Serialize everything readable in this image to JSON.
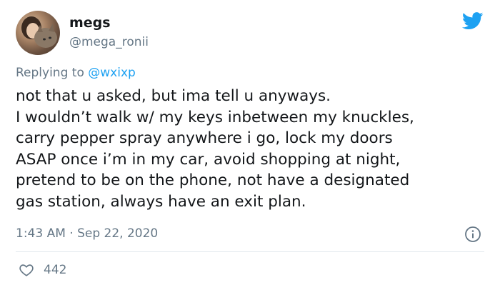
{
  "author": {
    "display_name": "megs",
    "handle": "@mega_ronii"
  },
  "reply": {
    "prefix": "Replying to ",
    "mention": "@wxixp"
  },
  "tweet": {
    "text": "not that u asked, but ima tell u anyways.\nI wouldn’t walk w/ my keys inbetween my knuckles,\ncarry pepper spray anywhere i go, lock my doors\nASAP once i’m in my car, avoid shopping at night,\npretend to be on the phone, not have a designated\ngas station, always have an exit plan.",
    "timestamp": "1:43 AM · Sep 22, 2020",
    "like_count": "442"
  },
  "icons": {
    "brand": "twitter-bird-icon",
    "info": "info-icon",
    "like": "heart-icon"
  },
  "colors": {
    "brand_blue": "#1da1f2",
    "secondary_text": "#657786",
    "primary_text": "#14171a",
    "divider": "#e1e8ed"
  }
}
